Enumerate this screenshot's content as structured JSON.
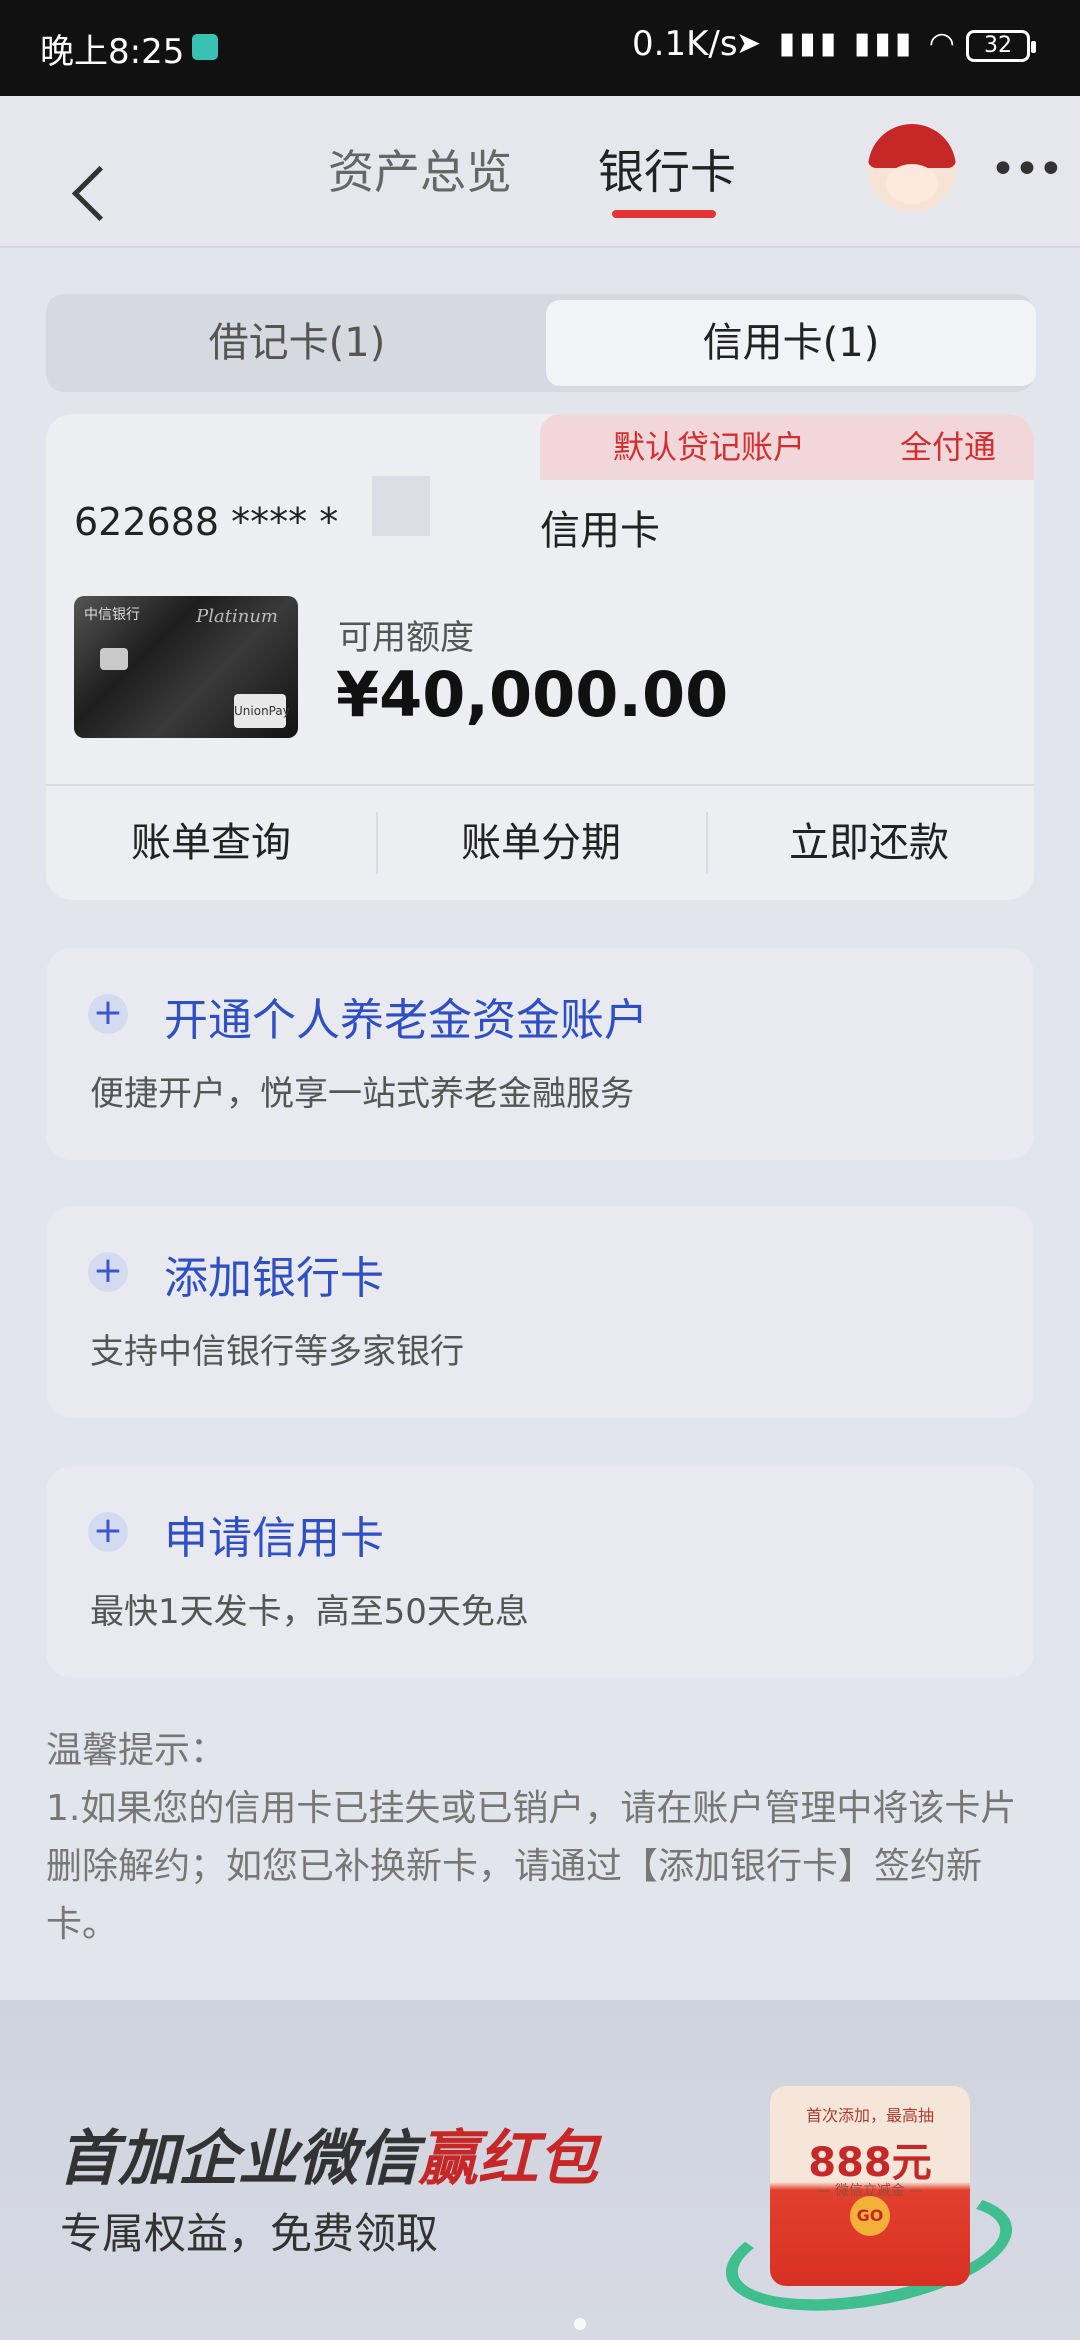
{
  "status_bar": {
    "time": "晚上8:25",
    "net_speed": "0.1K/s",
    "signal_icons": "➤ ▮▮▮ ▮▮▮ ◠",
    "battery": "32"
  },
  "nav": {
    "tabs": [
      "资产总览",
      "银行卡"
    ],
    "active_tab": "银行卡",
    "accent_color": "#e53434"
  },
  "segment": {
    "debit": "借记卡(1)",
    "credit": "信用卡(1)",
    "active": "信用卡(1)"
  },
  "card": {
    "tags": [
      "默认贷记账户",
      "全付通"
    ],
    "number": "622688 **** *",
    "type": "信用卡",
    "image": {
      "bank": "中信银行",
      "label": "Platinum",
      "network": "UnionPay 银联"
    },
    "available_label": "可用额度",
    "available_amount": "¥40,000.00",
    "actions": [
      "账单查询",
      "账单分期",
      "立即还款"
    ]
  },
  "panels": [
    {
      "icon": "plus-icon",
      "title": "开通个人养老金资金账户",
      "subtitle": "便捷开户，悦享一站式养老金融服务"
    },
    {
      "icon": "plus-icon",
      "title": "添加银行卡",
      "subtitle": "支持中信银行等多家银行"
    },
    {
      "icon": "plus-icon",
      "title": "申请信用卡",
      "subtitle": "最快1天发卡，高至50天免息"
    }
  ],
  "tip": {
    "title": "温馨提示：",
    "text": "1.如果您的信用卡已挂失或已销户，请在账户管理中将该卡片删除解约；如您已补换新卡，请通过【添加银行卡】签约新卡。"
  },
  "banner": {
    "title_a": "首加企业微信",
    "title_b": "赢红包",
    "subtitle": "专属权益，免费领取",
    "packet_top": "首次添加，最高抽",
    "packet_amount": "888元",
    "packet_small": "— 微信立减金 —",
    "packet_go": "GO"
  }
}
